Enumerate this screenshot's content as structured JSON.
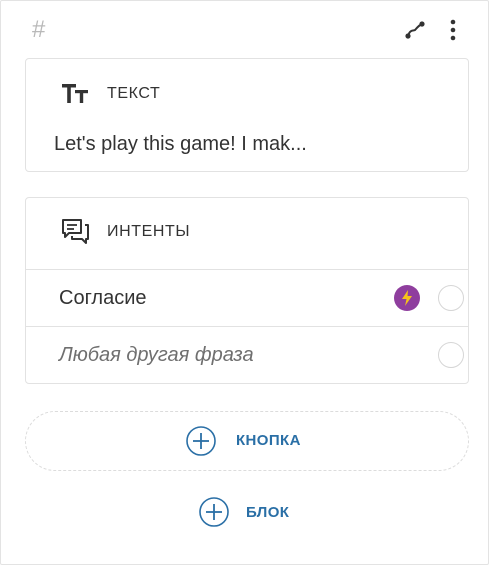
{
  "header": {
    "hash_symbol": "#",
    "connect_icon": "connector-icon",
    "more_icon": "more-vertical-icon"
  },
  "text_card": {
    "icon": "text-format-icon",
    "title": "ТЕКСТ",
    "preview": "Let's play this game! I mak..."
  },
  "intents_card": {
    "icon": "chat-bubbles-icon",
    "title": "ИНТЕНТЫ",
    "items": [
      {
        "label": "Согласие",
        "italic": false,
        "has_bolt": true
      },
      {
        "label": "Любая другая фраза",
        "italic": true,
        "has_bolt": false
      }
    ]
  },
  "actions": {
    "add_button_label": "КНОПКА",
    "add_block_label": "БЛОК"
  },
  "colors": {
    "accent_blue": "#2a6fa6",
    "bolt_purple": "#8f3e9e",
    "bolt_yellow": "#f5c21b",
    "border": "#e2e2e2"
  }
}
